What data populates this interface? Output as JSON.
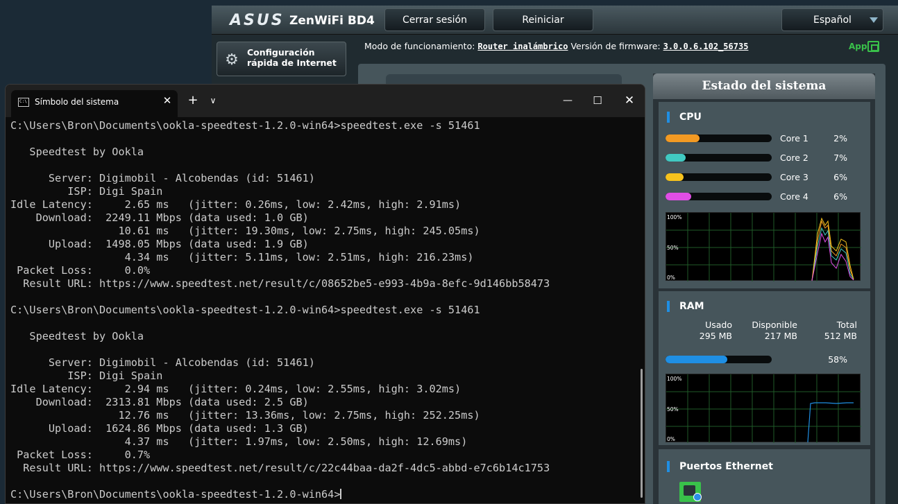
{
  "router": {
    "brand": "ASUS",
    "model": "ZenWiFi BD4",
    "logout_label": "Cerrar sesión",
    "reboot_label": "Reiniciar",
    "language": "Español",
    "quick_setup_label": "Configuración rápida de Internet",
    "mode_label": "Modo de funcionamiento:",
    "mode_value": "Router inalámbrico",
    "firmware_label": "Versión de firmware:",
    "firmware_value": "3.0.0.6.102_56735",
    "app_label": "App",
    "status_title": "Estado del sistema",
    "cpu": {
      "title": "CPU",
      "cores": [
        {
          "label": "Core 1",
          "value": "2%",
          "fill": 0.32,
          "color": "#f39a23"
        },
        {
          "label": "Core 2",
          "value": "7%",
          "fill": 0.19,
          "color": "#41c9c2"
        },
        {
          "label": "Core 3",
          "value": "6%",
          "fill": 0.17,
          "color": "#f6c21d"
        },
        {
          "label": "Core 4",
          "value": "6%",
          "fill": 0.24,
          "color": "#e04ee6"
        }
      ],
      "graph_labels": [
        "100%",
        "50%",
        "0%"
      ]
    },
    "ram": {
      "title": "RAM",
      "used_label": "Usado",
      "used_value": "295 MB",
      "free_label": "Disponible",
      "free_value": "217 MB",
      "total_label": "Total",
      "total_value": "512 MB",
      "percent": "58%",
      "fill": 0.58,
      "bar_color": "#1f8fe4",
      "graph_labels": [
        "100%",
        "50%",
        "0%"
      ]
    },
    "ethernet_title": "Puertos Ethernet"
  },
  "terminal": {
    "tab_title": "Símbolo del sistema",
    "lines": [
      "C:\\Users\\Bron\\Documents\\ookla-speedtest-1.2.0-win64>speedtest.exe -s 51461",
      "",
      "   Speedtest by Ookla",
      "",
      "      Server: Digimobil - Alcobendas (id: 51461)",
      "         ISP: Digi Spain",
      "Idle Latency:     2.65 ms   (jitter: 0.26ms, low: 2.42ms, high: 2.91ms)",
      "    Download:  2249.11 Mbps (data used: 1.0 GB)",
      "                 10.61 ms   (jitter: 19.30ms, low: 2.75ms, high: 245.05ms)",
      "      Upload:  1498.05 Mbps (data used: 1.9 GB)",
      "                  4.34 ms   (jitter: 5.11ms, low: 2.51ms, high: 216.23ms)",
      " Packet Loss:     0.0%",
      "  Result URL: https://www.speedtest.net/result/c/08652be5-e993-4b9a-8efc-9d146bb58473",
      "",
      "C:\\Users\\Bron\\Documents\\ookla-speedtest-1.2.0-win64>speedtest.exe -s 51461",
      "",
      "   Speedtest by Ookla",
      "",
      "      Server: Digimobil - Alcobendas (id: 51461)",
      "         ISP: Digi Spain",
      "Idle Latency:     2.94 ms   (jitter: 0.24ms, low: 2.55ms, high: 3.02ms)",
      "    Download:  2313.81 Mbps (data used: 2.5 GB)",
      "                 12.76 ms   (jitter: 13.36ms, low: 2.75ms, high: 252.25ms)",
      "      Upload:  1624.86 Mbps (data used: 1.3 GB)",
      "                  4.37 ms   (jitter: 1.97ms, low: 2.50ms, high: 12.69ms)",
      " Packet Loss:     0.7%",
      "  Result URL: https://www.speedtest.net/result/c/22c44baa-da2f-4dc5-abbd-e7c6b14c1753",
      "",
      "C:\\Users\\Bron\\Documents\\ookla-speedtest-1.2.0-win64>"
    ]
  }
}
